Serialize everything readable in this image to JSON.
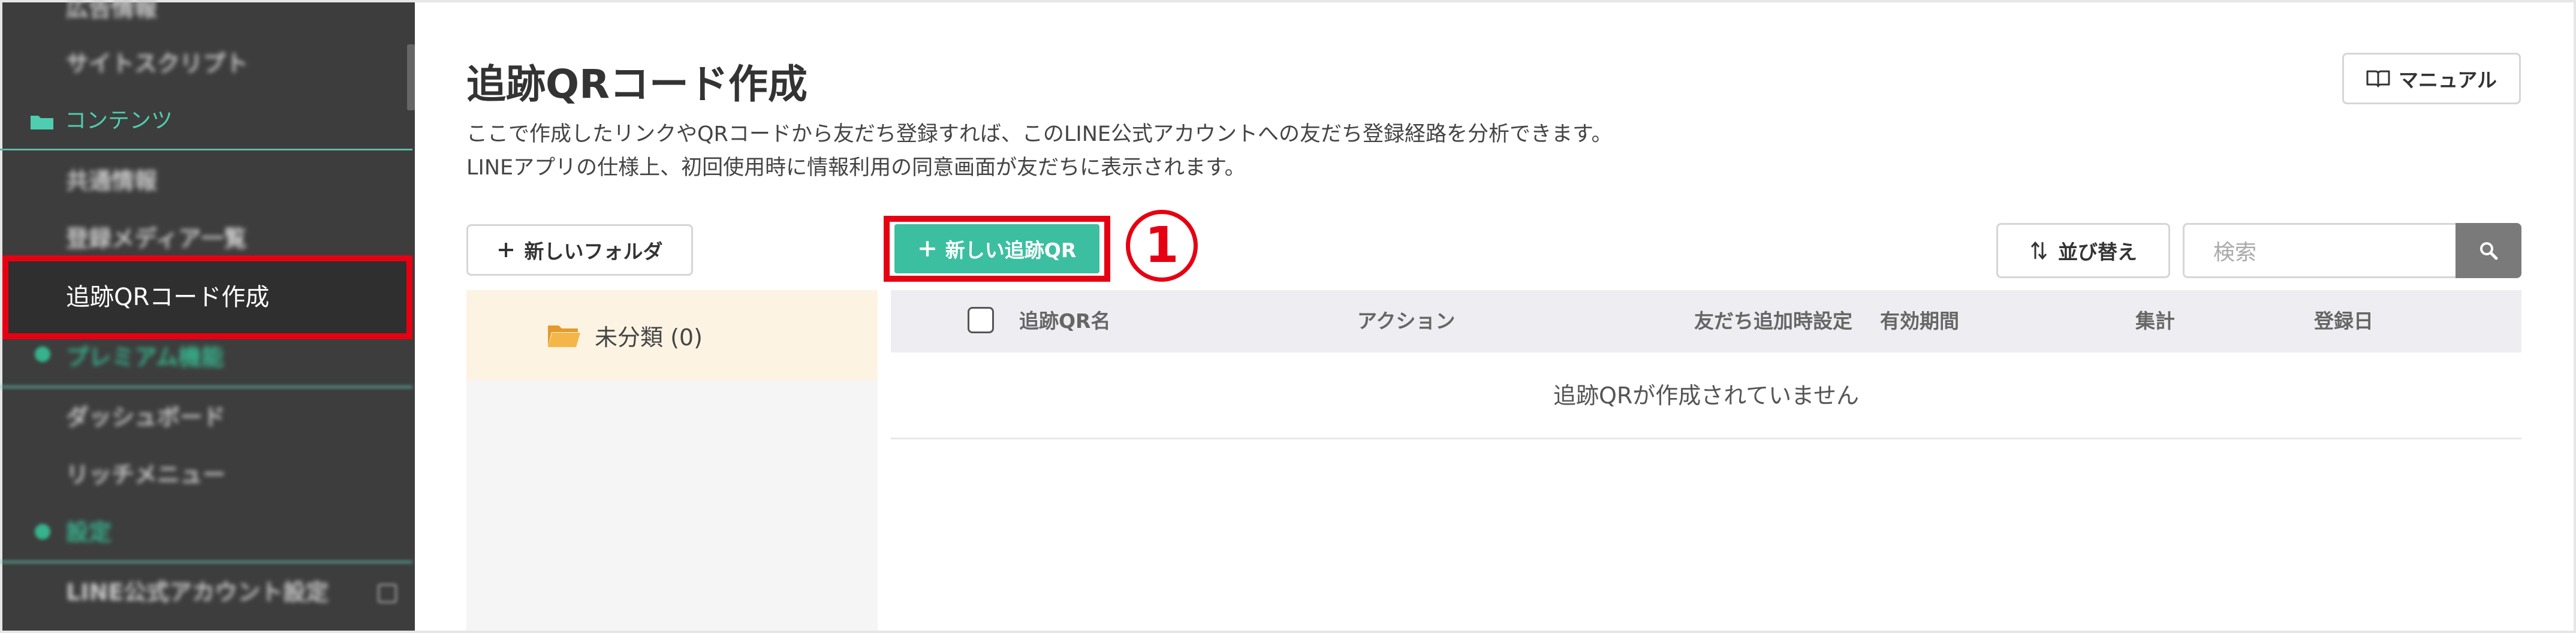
{
  "sidebar": {
    "items": [
      {
        "label": "広告情報"
      },
      {
        "label": "サイトスクリプト"
      },
      {
        "label": "コンテンツ"
      },
      {
        "label": "共通情報"
      },
      {
        "label": "登録メディア一覧"
      },
      {
        "label": "追跡QRコード作成"
      },
      {
        "label": "プレミアム機能"
      },
      {
        "label": "ダッシュボード"
      },
      {
        "label": "リッチメニュー"
      },
      {
        "label": "設定"
      },
      {
        "label": "LINE公式アカウント設定"
      }
    ]
  },
  "header": {
    "title": "追跡QRコード作成",
    "description_line1": "ここで作成したリンクやQRコードから友だち登録すれば、このLINE公式アカウントへの友だち登録経路を分析できます。",
    "description_line2": "LINEアプリの仕様上、初回使用時に情報利用の同意画面が友だちに表示されます。",
    "manual_label": "マニュアル"
  },
  "toolbar": {
    "new_folder_label": "新しいフォルダ",
    "new_qr_label": "新しい追跡QR",
    "callout_number": "1",
    "sort_label": "並び替え",
    "search_placeholder": "検索"
  },
  "folders": [
    {
      "label": "未分類 (0)"
    }
  ],
  "table": {
    "columns": [
      "追跡QR名",
      "アクション",
      "友だち追加時設定",
      "有効期間",
      "集計",
      "登録日"
    ],
    "empty_message": "追跡QRが作成されていません"
  },
  "colors": {
    "accent": "#3cbfa0",
    "highlight": "#e60012",
    "sidebar_bg": "#3d3d3d"
  }
}
